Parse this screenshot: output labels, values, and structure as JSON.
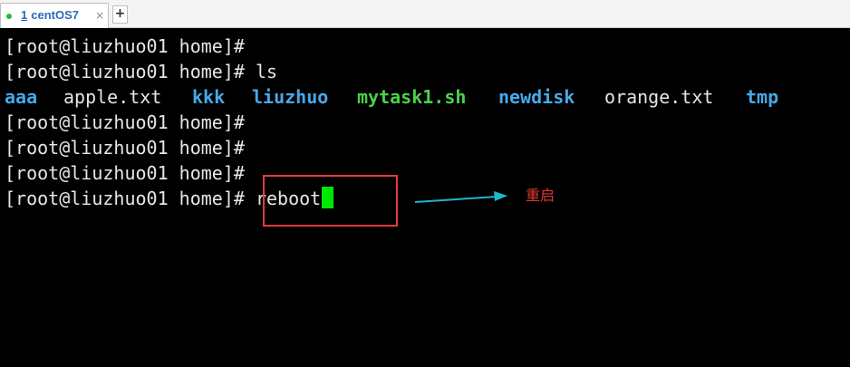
{
  "tab": {
    "number": "1",
    "title": "centOS7",
    "close_glyph": "×",
    "status_color": "#1fbf3a"
  },
  "new_tab_glyph": "+",
  "terminal": {
    "lines": [
      "[root@liuzhuo01 home]#",
      "[root@liuzhuo01 home]# ls",
      "",
      "[root@liuzhuo01 home]#",
      "[root@liuzhuo01 home]#",
      "[root@liuzhuo01 home]#"
    ],
    "ls_output": [
      {
        "name": "aaa",
        "type": "dir"
      },
      {
        "name": "apple.txt",
        "type": "file"
      },
      {
        "name": "kkk",
        "type": "dir"
      },
      {
        "name": "liuzhuo",
        "type": "dir"
      },
      {
        "name": "mytask1.sh",
        "type": "exec"
      },
      {
        "name": "newdisk",
        "type": "dir"
      },
      {
        "name": "orange.txt",
        "type": "file"
      },
      {
        "name": "tmp",
        "type": "dir"
      }
    ],
    "current_prompt": "[root@liuzhuo01 home]#",
    "current_command": " reboot",
    "colors": {
      "background": "#000000",
      "text": "#e6e6e6",
      "directory": "#47a9e9",
      "executable": "#4cd04c",
      "cursor": "#00e600"
    }
  },
  "annotation": {
    "label": "重启",
    "box_color": "#e33b3b",
    "arrow_color": "#1fb6c9",
    "text_color": "#e03a2e"
  }
}
